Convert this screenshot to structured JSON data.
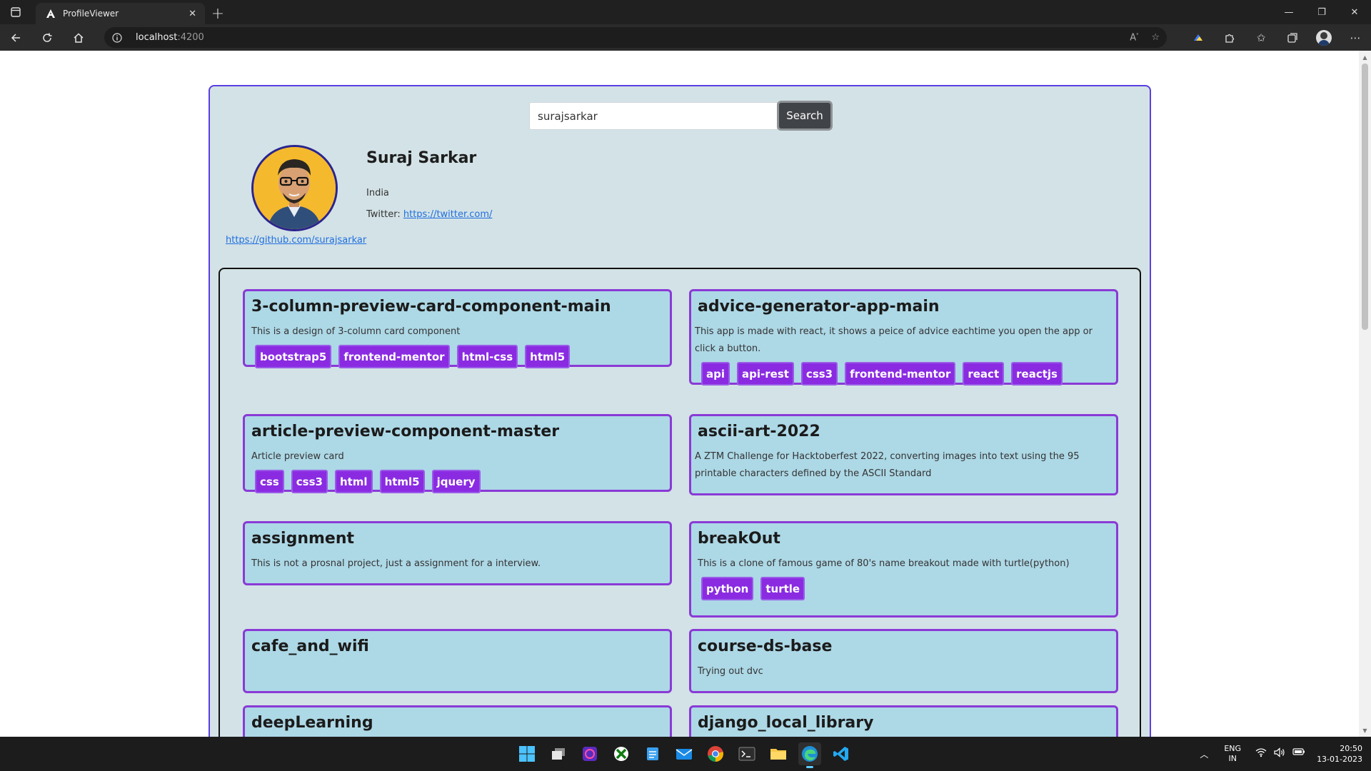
{
  "browser": {
    "tab_title": "ProfileViewer",
    "tab_close": "✕",
    "new_tab": "+",
    "url_host": "localhost",
    "url_port": ":4200",
    "window_controls": {
      "minimize": "—",
      "maximize": "❐",
      "close": "✕"
    }
  },
  "search": {
    "value": "surajsarkar",
    "button_label": "Search"
  },
  "profile": {
    "name": "Suraj Sarkar",
    "country": "India",
    "twitter_label": "Twitter: ",
    "twitter_url": "https://twitter.com/",
    "github_url": "https://github.com/surajsarkar"
  },
  "repos": [
    {
      "name": "3-column-preview-card-component-main",
      "description": "This is a design of 3-column card component",
      "topics": [
        "bootstrap5",
        "frontend-mentor",
        "html-css",
        "html5"
      ]
    },
    {
      "name": "advice-generator-app-main",
      "description": " This app is made with react, it shows a peice of advice eachtime you open the app or click a button.",
      "topics": [
        "api",
        "api-rest",
        "css3",
        "frontend-mentor",
        "react",
        "reactjs"
      ]
    },
    {
      "name": "article-preview-component-master",
      "description": "Article preview card",
      "topics": [
        "css",
        "css3",
        "html",
        "html5",
        "jquery"
      ]
    },
    {
      "name": "ascii-art-2022",
      "description": " A ZTM Challenge for Hacktoberfest 2022, converting images into text using the 95 printable characters defined by the ASCII Standard",
      "topics": []
    },
    {
      "name": "assignment",
      "description": "This is not a prosnal project, just a assignment for a interview.",
      "topics": []
    },
    {
      "name": "breakOut",
      "description": "This is a clone of famous game of 80's name breakout made with turtle(python)",
      "topics": [
        "python",
        "turtle"
      ]
    },
    {
      "name": "cafe_and_wifi",
      "description": "",
      "topics": []
    },
    {
      "name": "course-ds-base",
      "description": "Trying out dvc",
      "topics": []
    },
    {
      "name": "deepLearning",
      "description": "",
      "topics": []
    },
    {
      "name": "django_local_library",
      "description": "",
      "topics": []
    }
  ],
  "taskbar": {
    "icons": [
      "windows-start-icon",
      "task-view-icon",
      "app-icon",
      "xbox-icon",
      "notepad-icon",
      "mail-icon",
      "chrome-icon",
      "terminal-icon",
      "file-explorer-icon",
      "edge-icon",
      "vscode-icon"
    ],
    "language_top": "ENG",
    "language_bottom": "IN",
    "time": "20:50",
    "date": "13-01-2023"
  }
}
